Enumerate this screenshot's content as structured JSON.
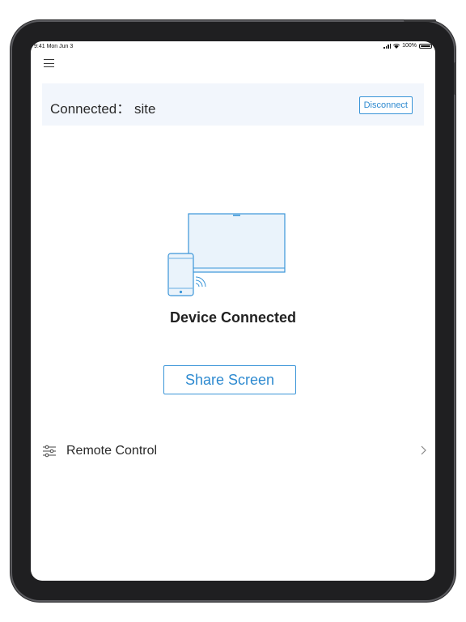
{
  "status_bar": {
    "time": "9:41 Mon Jun 3",
    "battery": "100%"
  },
  "connection": {
    "label": "Connected： site",
    "disconnect_label": "Disconnect"
  },
  "main": {
    "status_title": "Device Connected",
    "share_label": "Share Screen"
  },
  "remote": {
    "label": "Remote Control"
  },
  "colors": {
    "accent": "#2e8ad0",
    "bar_background": "#f2f6fc"
  },
  "icons": [
    "menu-icon",
    "signal-icon",
    "wifi-icon",
    "battery-icon",
    "device-illustration",
    "sliders-icon",
    "chevron-right-icon"
  ]
}
